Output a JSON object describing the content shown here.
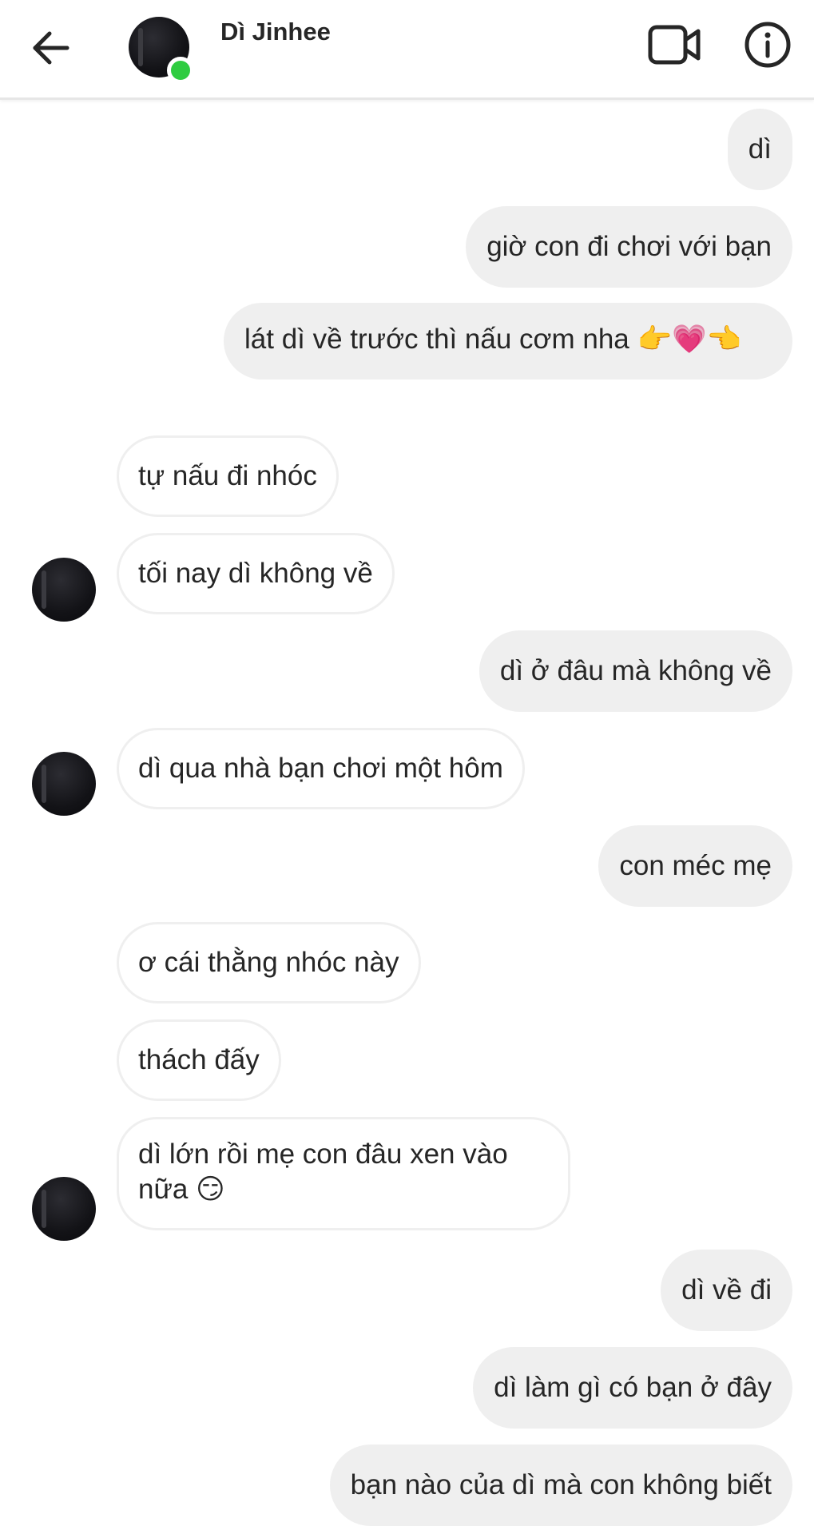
{
  "header": {
    "contact_name": "Dì Jinhee",
    "online": true,
    "online_color": "#2ecc40",
    "back_icon": "arrow-left-icon",
    "video_icon": "video-call-icon",
    "info_icon": "info-icon"
  },
  "messages": [
    {
      "side": "out",
      "text": "dì"
    },
    {
      "side": "out",
      "text": "giờ con đi chơi với bạn"
    },
    {
      "side": "out",
      "text": "lát dì về trước thì nấu cơm nha 👉💗👈"
    },
    {
      "side": "in",
      "text": "tự nấu đi nhóc"
    },
    {
      "side": "in",
      "text": "tối nay dì không về"
    },
    {
      "side": "out",
      "text": "dì ở đâu mà không về"
    },
    {
      "side": "in",
      "text": "dì qua nhà bạn chơi một hôm"
    },
    {
      "side": "out",
      "text": "con méc mẹ"
    },
    {
      "side": "in",
      "text": "ơ cái thằng nhóc này"
    },
    {
      "side": "in",
      "text": "thách đấy"
    },
    {
      "side": "in",
      "text": "dì lớn rồi mẹ con đâu xen vào nữa 😏"
    },
    {
      "side": "out",
      "text": "dì về đi"
    },
    {
      "side": "out",
      "text": "dì làm gì có bạn ở đây"
    },
    {
      "side": "out",
      "text": "bạn nào của dì mà con không biết"
    }
  ]
}
